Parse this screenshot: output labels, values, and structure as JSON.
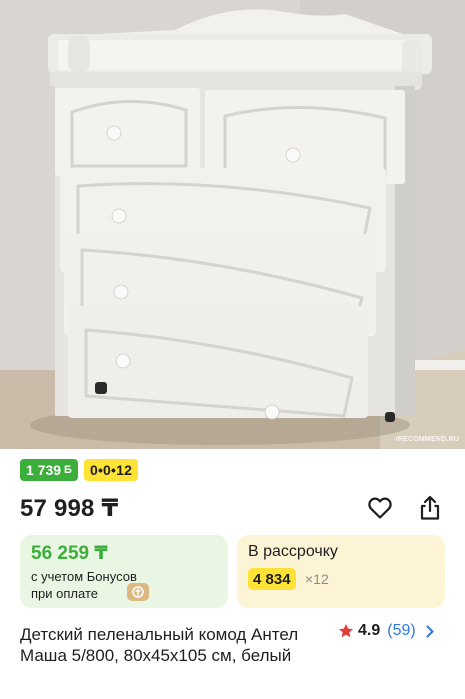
{
  "photo": {
    "alt": "Детский пеленальный комод Антел Маша 5/800",
    "watermark": "iRECOMMEND.RU"
  },
  "badges": {
    "bonus_value": "1 739",
    "bonus_coin": "Б",
    "installment": "0•0•12"
  },
  "price": {
    "main": "57 998 ₸"
  },
  "actions": {
    "favorite_icon": "heart-outline-icon",
    "share_icon": "share-icon"
  },
  "bonus_card": {
    "price": "56 259 ₸",
    "note_line1": "с учетом Бонусов",
    "note_line2": "при оплате",
    "chip_icon": "payment-chip-icon"
  },
  "credit_card": {
    "title": "В рассрочку",
    "amount": "4 834",
    "months": "×12"
  },
  "product": {
    "title": "Детский пеленальный комод Антел Маша 5/800, 80х45х105 см, белый",
    "rating_value": "4.9",
    "rating_count": "(59)"
  },
  "colors": {
    "green": "#3cae3c",
    "yellow": "#ffe236",
    "link_blue": "#3377dd",
    "star_red": "#e0403a"
  }
}
